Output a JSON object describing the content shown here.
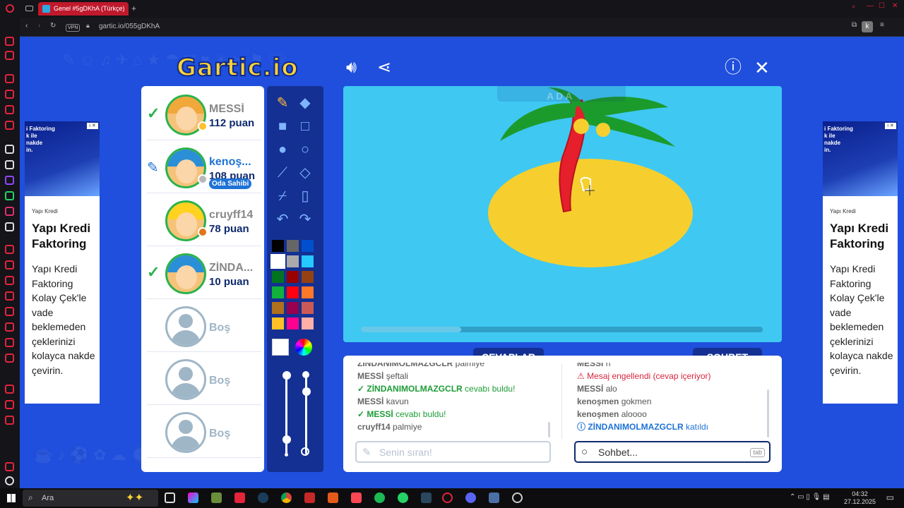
{
  "browser": {
    "tab_title": "Genel #5gDKhA (Türkçe)",
    "new_tab_symbol": "+",
    "vpn_label": "VPN",
    "url": "gartic.io/055gDKhA",
    "profile_initial": "k"
  },
  "header": {
    "logo_main": "Gartic",
    "logo_suffix": ".io"
  },
  "players": [
    {
      "name": "MESSİ",
      "score": "112 puan",
      "status": "check",
      "hair": "#f0a83a",
      "dot": "#ffc02e"
    },
    {
      "name": "kenoş...",
      "score": "108 puan",
      "status": "drawing",
      "badge": "Oda Sahibi",
      "hair": "#2a8fd6",
      "dot": "#b8b8b8"
    },
    {
      "name": "cruyff14",
      "score": "78 puan",
      "status": "none",
      "hair": "#ffd21f",
      "dot": "#e2761b"
    },
    {
      "name": "ZİNDA...",
      "score": "10 puan",
      "status": "check",
      "hair": "#2a8fd6",
      "dot": ""
    },
    {
      "name": "Boş",
      "empty": true
    },
    {
      "name": "Boş",
      "empty": true
    },
    {
      "name": "Boş",
      "empty": true
    }
  ],
  "tools": {
    "icons": [
      "pencil-icon",
      "eraser-icon",
      "filled-rect-icon",
      "rect-icon",
      "filled-circle-icon",
      "circle-icon",
      "line-icon",
      "fill-bucket-icon",
      "eyedropper-icon",
      "page-icon",
      "undo-icon",
      "redo-icon"
    ],
    "palette": [
      "#000000",
      "#666666",
      "#0050cd",
      "#ffffff",
      "#aaaaaa",
      "#26c9ff",
      "#017420",
      "#990000",
      "#964112",
      "#11b03c",
      "#ff0013",
      "#ff7829",
      "#b0701c",
      "#99004e",
      "#cb5a57",
      "#ffc126",
      "#ff008f",
      "#feafa8"
    ],
    "selected_color": "#ffffff",
    "brush_size": 0.15,
    "opacity": 0.85
  },
  "canvas": {
    "hint_word": "ADA",
    "progress": 0.25
  },
  "tabs": {
    "answers": "CEVAPLAR",
    "chat": "SOHBET"
  },
  "answers_feed": [
    {
      "user": "ZİNDANIMOLMAZGCLR",
      "text": "palmiye",
      "type": "msg",
      "cut": true
    },
    {
      "user": "MESSİ",
      "text": "şeftali",
      "type": "msg"
    },
    {
      "user": "ZİNDANIMOLMAZGCLR",
      "text": "cevabı buldu!",
      "type": "found"
    },
    {
      "user": "MESSİ",
      "text": "kavun",
      "type": "msg"
    },
    {
      "user": "MESSİ",
      "text": "cevabı buldu!",
      "type": "found"
    },
    {
      "user": "cruyff14",
      "text": "palmiye",
      "type": "msg"
    }
  ],
  "chat_feed": [
    {
      "user": "MESSİ",
      "text": "n",
      "type": "msg",
      "cut": true
    },
    {
      "user": "",
      "text": "Mesaj engellendi (cevap içeriyor)",
      "type": "blocked"
    },
    {
      "user": "MESSİ",
      "text": "alo",
      "type": "msg"
    },
    {
      "user": "kenoşmen",
      "text": "gokmen",
      "type": "msg"
    },
    {
      "user": "kenoşmen",
      "text": "aloooo",
      "type": "msg"
    },
    {
      "user": "ZİNDANIMOLMAZGCLR",
      "text": "katıldı",
      "type": "joined"
    }
  ],
  "answer_input": {
    "placeholder": "Senin sıran!"
  },
  "chat_input": {
    "placeholder": "Sohbet...",
    "key_hint": "tab"
  },
  "ad": {
    "image_text": "i Faktoring\nk ile\nnakde\nin.",
    "advertiser": "Yapı Kredi",
    "title": "Yapı Kredi Faktoring",
    "body": "Yapı Kredi Faktoring Kolay Çek'le vade beklemeden çeklerinizi kolayca nakde çevirin.",
    "info_label": "i ✕"
  },
  "taskbar": {
    "search_placeholder": "Ara",
    "time": "04:32",
    "date": "27.12.2025"
  }
}
